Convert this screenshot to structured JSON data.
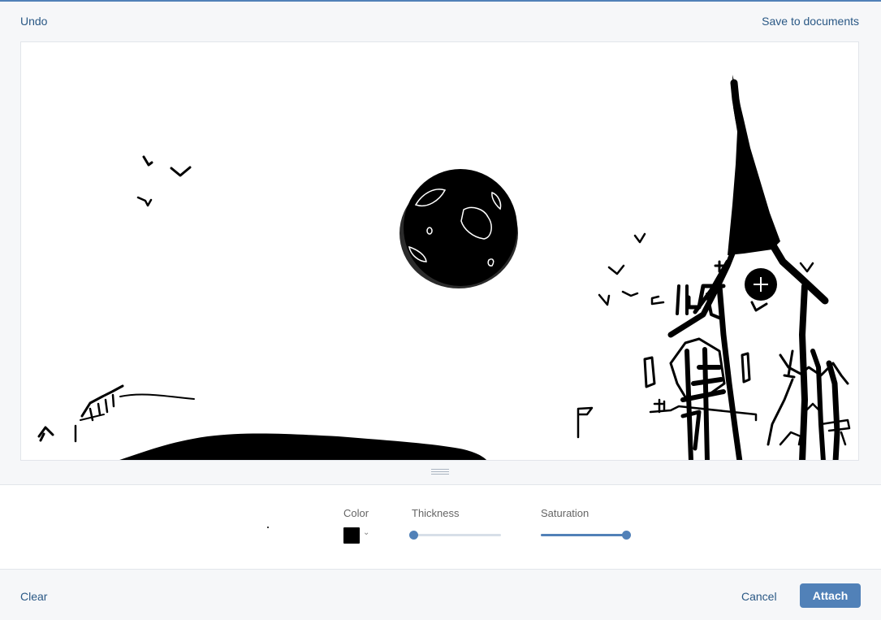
{
  "toolbar": {
    "undo_label": "Undo",
    "save_label": "Save to documents"
  },
  "tools": {
    "color": {
      "label": "Color",
      "value": "#000000",
      "expand_icon": "chevron-down-icon"
    },
    "thickness": {
      "label": "Thickness",
      "value": 0
    },
    "saturation": {
      "label": "Saturation",
      "value": 1
    }
  },
  "footer": {
    "clear_label": "Clear",
    "cancel_label": "Cancel",
    "attach_label": "Attach"
  },
  "colors": {
    "accent": "#5181b8",
    "link": "#2a5885"
  }
}
